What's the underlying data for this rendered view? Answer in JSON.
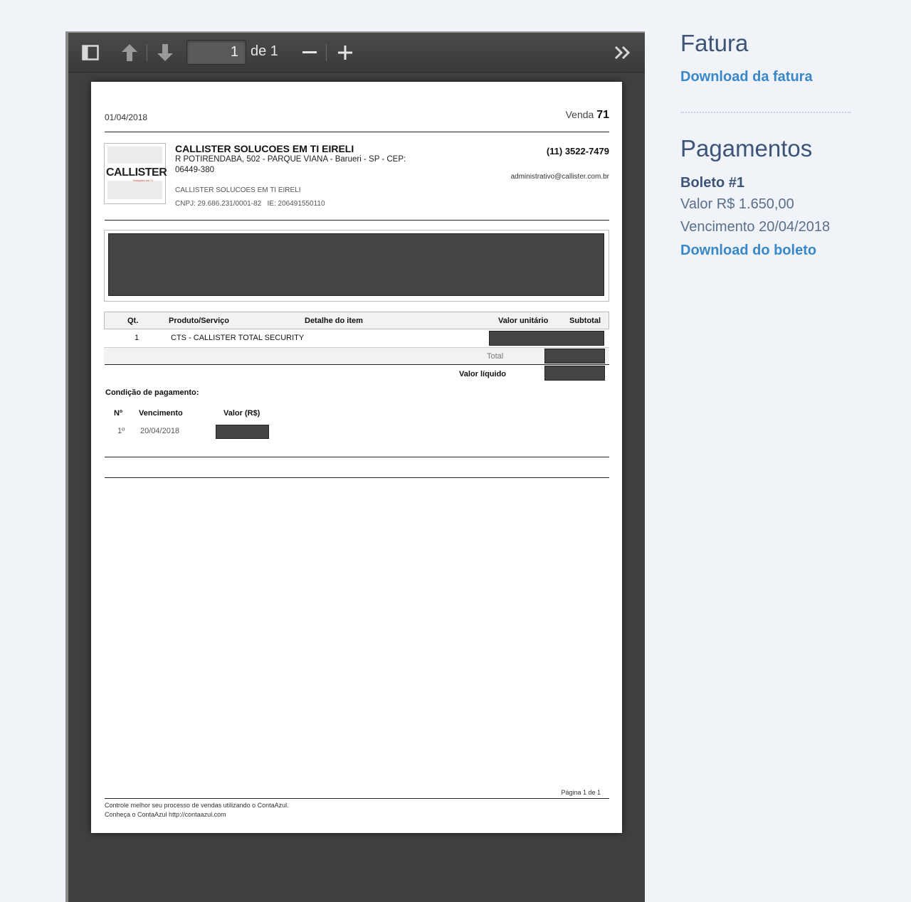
{
  "viewer": {
    "page_current": "1",
    "page_of": "de 1",
    "zoom_out_label": "—",
    "zoom_in_label": "+"
  },
  "invoice": {
    "date": "01/04/2018",
    "sale_label": "Venda",
    "sale_number": "71",
    "company_name": "CALLISTER SOLUCOES EM TI EIRELI",
    "address_line1": "R POTIRENDABA, 502 - PARQUE VIANA - Barueri - SP - CEP:",
    "address_line2": "06449-380",
    "company_legal": "CALLISTER SOLUCOES EM TI EIRELI",
    "cnpj": "CNPJ: 29.686.231/0001-82",
    "ie": "IE: 206491550110",
    "phone": "(11) 3522-7479",
    "email": "administrativo@callister.com.br",
    "logo_text": "CALLISTER",
    "logo_sub": "Soluções em TI",
    "table_headers": {
      "qt": "Qt.",
      "product": "Produto/Serviço",
      "detail": "Detalhe do item",
      "unit_value": "Valor unitário",
      "subtotal": "Subtotal"
    },
    "items": [
      {
        "qt": "1",
        "product": "CTS - CALLISTER TOTAL SECURITY"
      }
    ],
    "total_label": "Total",
    "net_label": "Valor líquido",
    "payment_condition": "Condição de pagamento:",
    "payment_headers": {
      "n": "Nº",
      "due": "Vencimento",
      "value": "Valor (R$)"
    },
    "payments": [
      {
        "n": "1º",
        "due": "20/04/2018"
      }
    ],
    "page_footer": "Página 1 de 1",
    "footer_line1": "Controle melhor seu processo de vendas utilizando o ContaAzul.",
    "footer_line2": "Conheça o ContaAzul  http://contaazul.com"
  },
  "sidebar": {
    "fatura_title": "Fatura",
    "download_fatura": "Download da fatura",
    "pagamentos_title": "Pagamentos",
    "boleto_label": "Boleto #1",
    "valor_text": "Valor R$ 1.650,00",
    "vencimento_text": "Vencimento 20/04/2018",
    "download_boleto": "Download do boleto"
  }
}
